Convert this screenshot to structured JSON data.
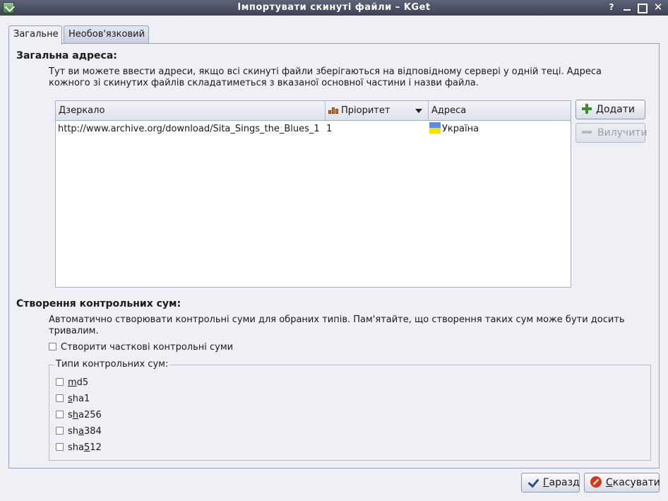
{
  "window": {
    "title": "Імпортувати скинуті файли – KGet",
    "help_glyph": "?"
  },
  "tabs": [
    {
      "label": "Загальне",
      "active": true
    },
    {
      "label": "Необов'язковий",
      "active": false
    }
  ],
  "general_address": {
    "heading": "Загальна адреса:",
    "description_line1": "Тут ви можете ввести адреси, якщо всі скинуті файли зберігаються на відповідному сервері у одній теці. Адреса",
    "description_line2": "кожного зі скинутих файлів складатиметься з вказаної основної частини і назви файла.",
    "columns": [
      "Дзеркало",
      "Пріоритет",
      "Адреса"
    ],
    "rows": [
      {
        "mirror": "http://www.archive.org/download/Sita_Sings_the_Blues_1",
        "priority": "1",
        "location": "Україна",
        "flag_colors": [
          "#5b8de0",
          "#f2e400"
        ]
      }
    ],
    "add_button": "Додати",
    "remove_button": "Вилучити"
  },
  "checksums": {
    "heading": "Створення контрольних сум:",
    "description_line1": "Автоматично створювати контрольні суми для обраних типів. Пам'ятайте, що створення таких сум може бути досить",
    "description_line2": "тривалим.",
    "partial_label": "Створити часткові контрольні суми",
    "partial_checked": false,
    "types_legend": "Типи контрольних сум:",
    "types": [
      {
        "pre": "",
        "mn": "m",
        "post": "d5",
        "checked": false
      },
      {
        "pre": "",
        "mn": "s",
        "post": "ha1",
        "checked": false
      },
      {
        "pre": "s",
        "mn": "h",
        "post": "a256",
        "checked": false
      },
      {
        "pre": "sh",
        "mn": "a",
        "post": "384",
        "checked": false
      },
      {
        "pre": "sha",
        "mn": "5",
        "post": "12",
        "checked": false
      }
    ]
  },
  "footer": {
    "ok_mnemonic": "Г",
    "ok_rest": "аразд",
    "cancel_mnemonic": "С",
    "cancel_rest": "касувати"
  },
  "colors": {
    "titlebar": "#4b5164",
    "accent_green": "#3e8d2f",
    "cancel_red": "#d03a1a"
  }
}
